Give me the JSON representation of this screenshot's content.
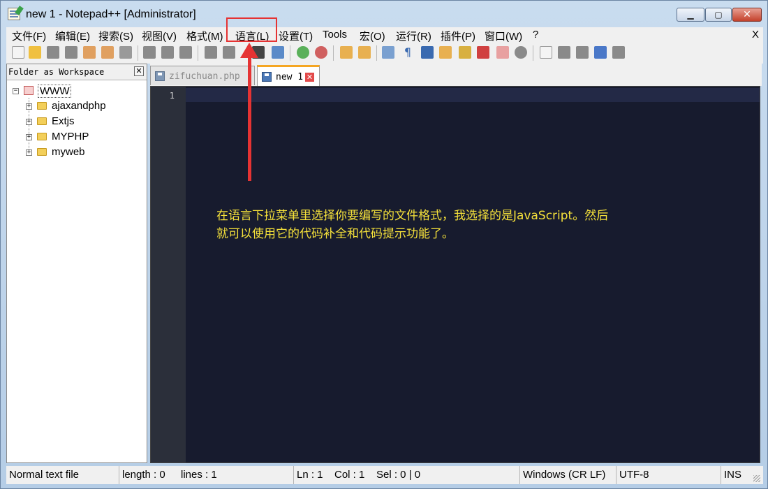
{
  "window": {
    "title": "new 1 - Notepad++ [Administrator]",
    "minimize": "▁",
    "maximize": "▢",
    "close": "✕"
  },
  "menu": {
    "items": [
      "文件(F)",
      "编辑(E)",
      "搜索(S)",
      "视图(V)",
      "格式(M)",
      "语言(L)",
      "设置(T)",
      "Tools",
      "宏(O)",
      "运行(R)",
      "插件(P)",
      "窗口(W)",
      "?"
    ],
    "close_label": "X",
    "highlighted": "语言(L)"
  },
  "sidebar": {
    "title": "Folder as Workspace",
    "close": "✕",
    "root": "WWW",
    "folders": [
      "ajaxandphp",
      "Extjs",
      "MYPHP",
      "myweb"
    ]
  },
  "tabs": [
    {
      "label": "zifuchuan.php",
      "active": false
    },
    {
      "label": "new 1",
      "active": true,
      "close": "✕"
    }
  ],
  "editor": {
    "line_number": "1",
    "annotation_line1": "在语言下拉菜单里选择你要编写的文件格式，我选择的是JavaScript。然后",
    "annotation_line2": "就可以使用它的代码补全和代码提示功能了。"
  },
  "statusbar": {
    "file_type": "Normal text file",
    "length": "length : 0",
    "lines": "lines : 1",
    "ln": "Ln : 1",
    "col": "Col : 1",
    "sel": "Sel : 0 | 0",
    "eol": "Windows (CR LF)",
    "encoding": "UTF-8",
    "mode": "INS"
  },
  "colors": {
    "editor_bg": "#171b2e",
    "annotation": "#f5e13a",
    "callout": "#e53333",
    "active_tab_accent": "#f5a623"
  }
}
